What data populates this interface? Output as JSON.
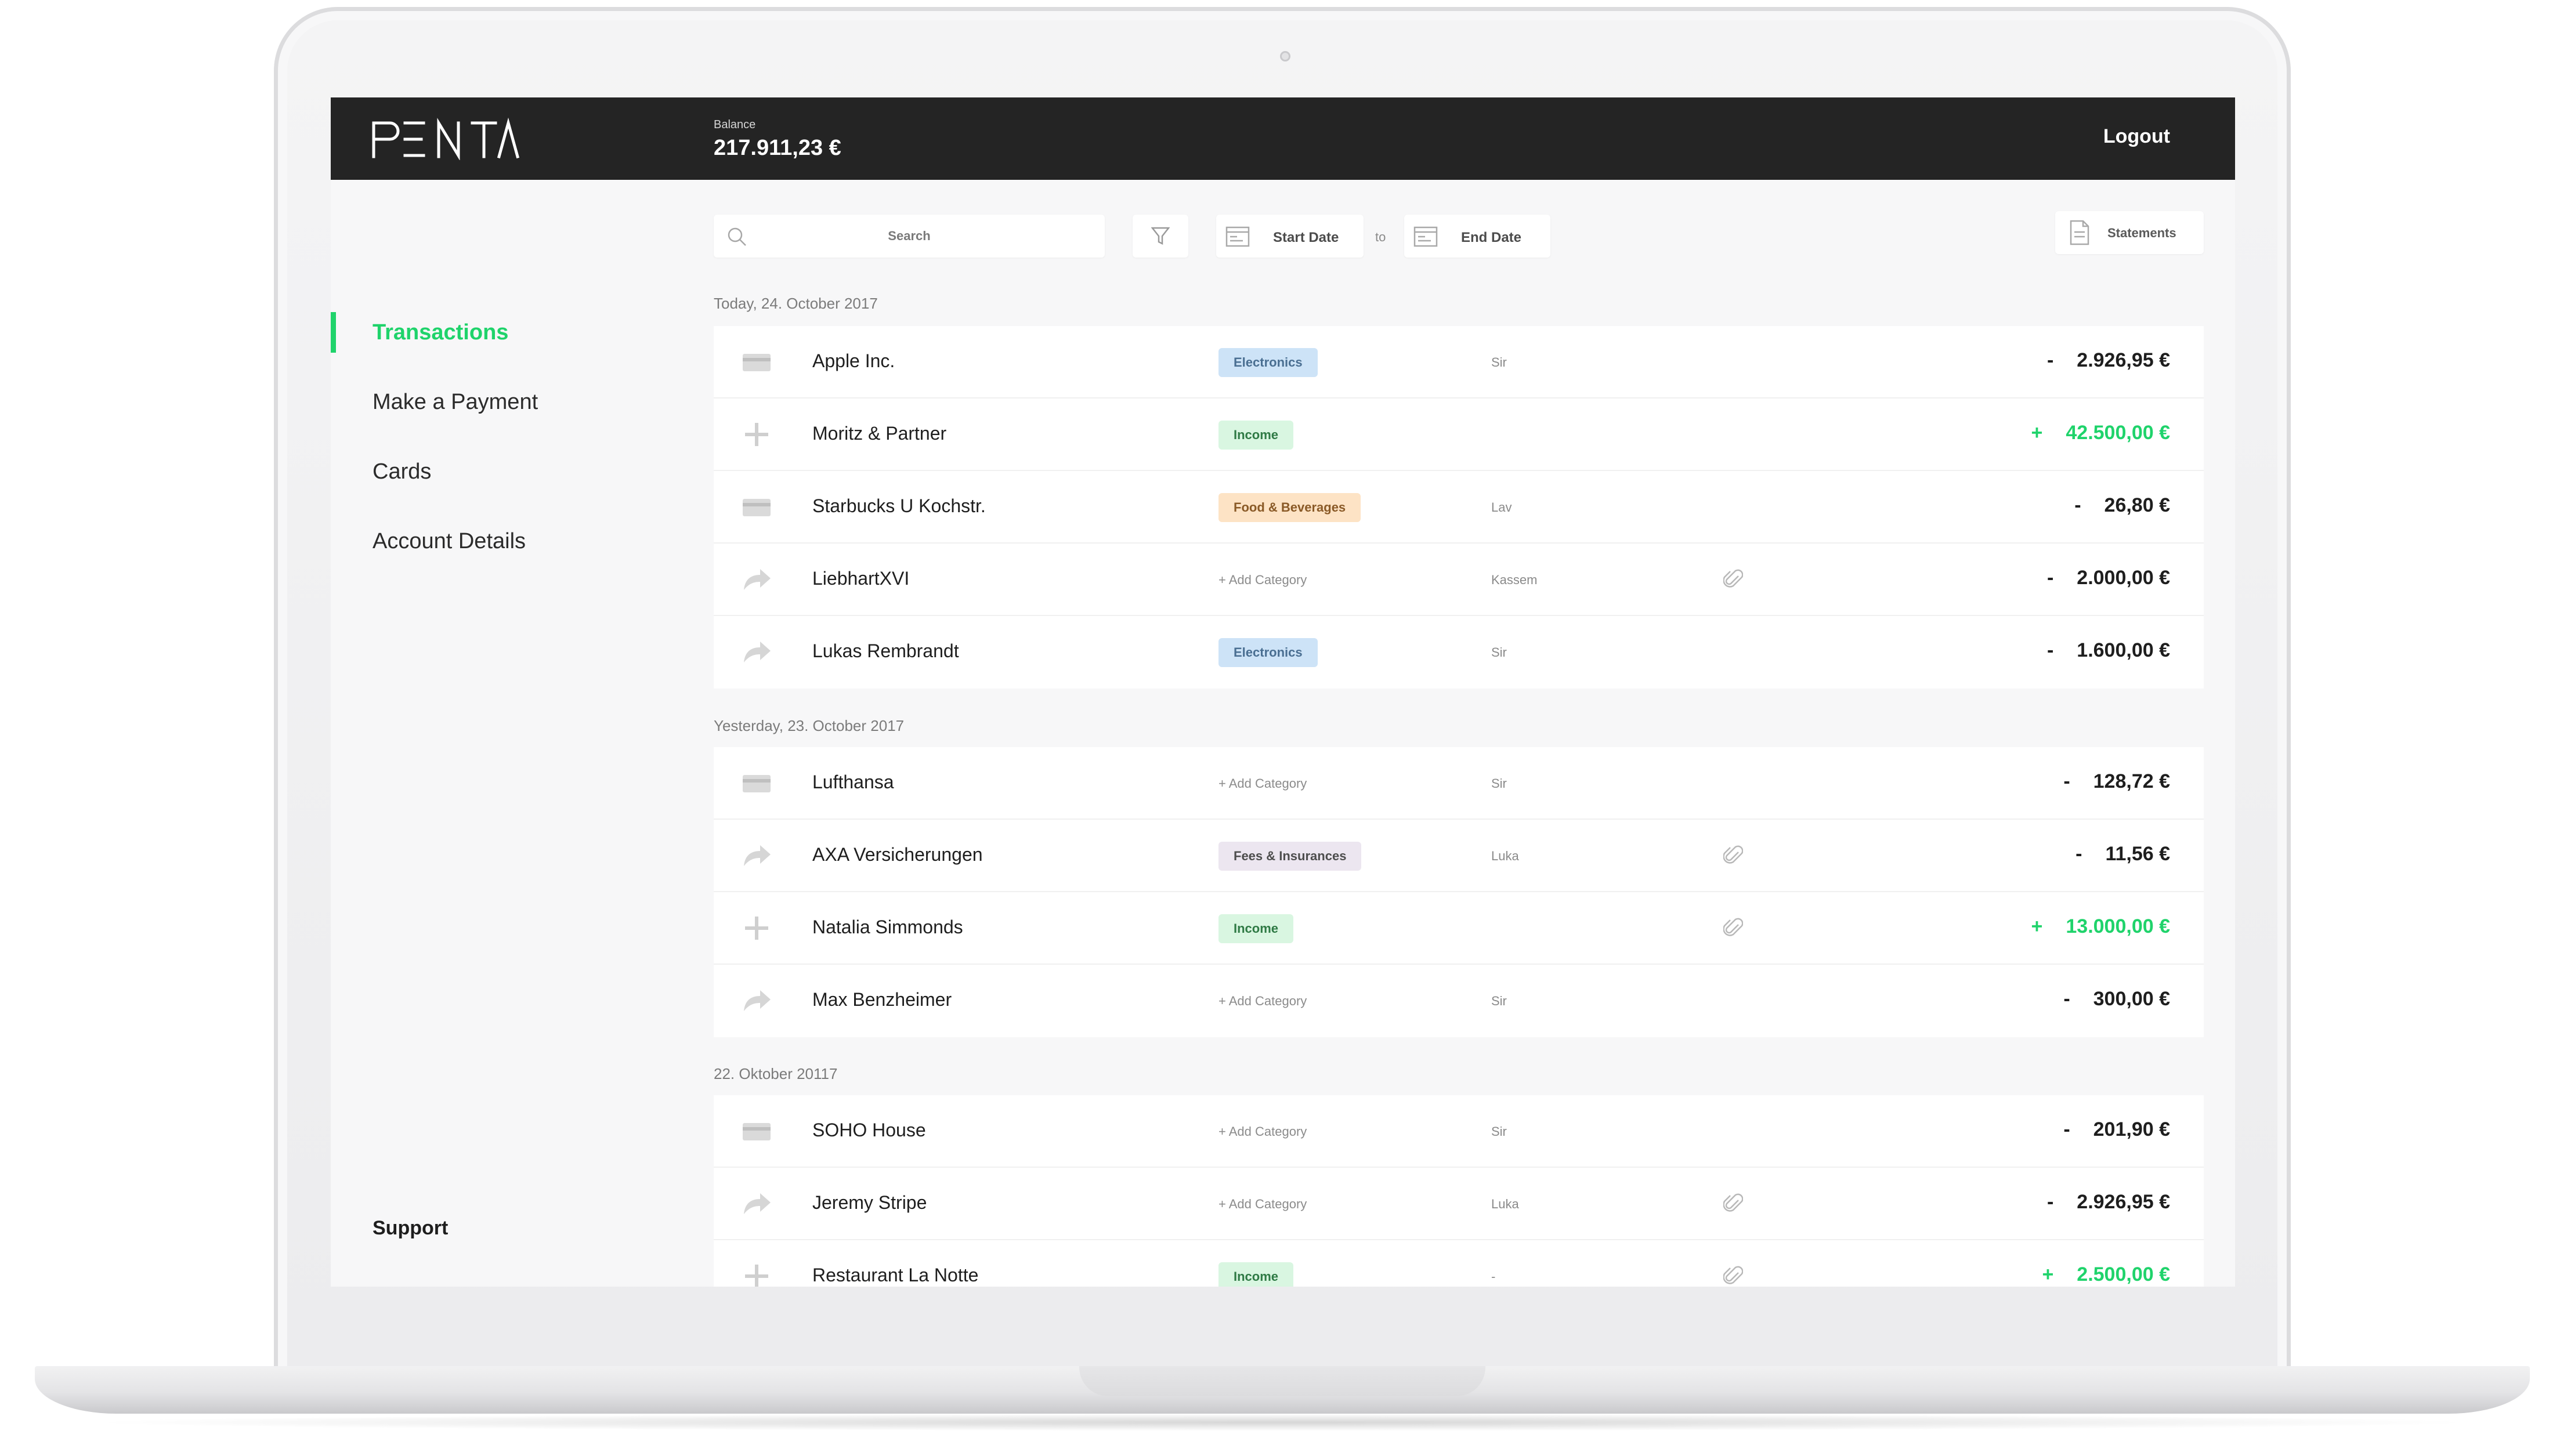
{
  "app": {
    "brand": "PENTA",
    "balance_label": "Balance",
    "balance_value": "217.911,23 €",
    "logout_label": "Logout"
  },
  "sidebar": {
    "items": [
      {
        "label": "Transactions",
        "active": true
      },
      {
        "label": "Make a Payment",
        "active": false
      },
      {
        "label": "Cards",
        "active": false
      },
      {
        "label": "Account Details",
        "active": false
      }
    ],
    "support_label": "Support"
  },
  "toolbar": {
    "search_label": "Search",
    "start_date_label": "Start Date",
    "to_label": "to",
    "end_date_label": "End Date",
    "statements_label": "Statements"
  },
  "colors": {
    "accent_green": "#1fd36b",
    "topbar": "#242424",
    "tag_electronics": "#cde3f7",
    "tag_income": "#d9f6e1",
    "tag_food": "#fde3c5",
    "tag_fees": "#ece6f0"
  },
  "groups": [
    {
      "header": "Today, 24. October 2017",
      "rows": [
        {
          "icon": "card-icon",
          "name": "Apple Inc.",
          "category": "Electronics",
          "category_type": "electronics",
          "person": "Sir",
          "attachment": false,
          "sign": "-",
          "amount": "2.926,95 €",
          "positive": false
        },
        {
          "icon": "plus-icon",
          "name": "Moritz & Partner",
          "category": "Income",
          "category_type": "income",
          "person": "",
          "attachment": false,
          "sign": "+",
          "amount": "42.500,00 €",
          "positive": true
        },
        {
          "icon": "card-icon",
          "name": "Starbucks U Kochstr.",
          "category": "Food & Beverages",
          "category_type": "food",
          "person": "Lav",
          "attachment": false,
          "sign": "-",
          "amount": "26,80 €",
          "positive": false
        },
        {
          "icon": "transfer-arrow-icon",
          "name": "LiebhartXVI",
          "category": "+ Add Category",
          "category_type": "add",
          "person": "Kassem",
          "attachment": true,
          "sign": "-",
          "amount": "2.000,00 €",
          "positive": false
        },
        {
          "icon": "transfer-arrow-icon",
          "name": "Lukas Rembrandt",
          "category": "Electronics",
          "category_type": "electronics",
          "person": "Sir",
          "attachment": false,
          "sign": "-",
          "amount": "1.600,00 €",
          "positive": false
        }
      ]
    },
    {
      "header": "Yesterday, 23. October 2017",
      "rows": [
        {
          "icon": "card-icon",
          "name": "Lufthansa",
          "category": "+ Add Category",
          "category_type": "add",
          "person": "Sir",
          "attachment": false,
          "sign": "-",
          "amount": "128,72 €",
          "positive": false
        },
        {
          "icon": "transfer-arrow-icon",
          "name": "AXA Versicherungen",
          "category": "Fees & Insurances",
          "category_type": "fees",
          "person": "Luka",
          "attachment": true,
          "sign": "-",
          "amount": "11,56 €",
          "positive": false
        },
        {
          "icon": "plus-icon",
          "name": "Natalia Simmonds",
          "category": "Income",
          "category_type": "income",
          "person": "",
          "attachment": true,
          "sign": "+",
          "amount": "13.000,00 €",
          "positive": true
        },
        {
          "icon": "transfer-arrow-icon",
          "name": "Max Benzheimer",
          "category": "+ Add Category",
          "category_type": "add",
          "person": "Sir",
          "attachment": false,
          "sign": "-",
          "amount": "300,00 €",
          "positive": false
        }
      ]
    },
    {
      "header": "22. Oktober 20117",
      "rows": [
        {
          "icon": "card-icon",
          "name": "SOHO House",
          "category": "+ Add Category",
          "category_type": "add",
          "person": "Sir",
          "attachment": false,
          "sign": "-",
          "amount": "201,90 €",
          "positive": false
        },
        {
          "icon": "transfer-arrow-icon",
          "name": "Jeremy Stripe",
          "category": "+ Add Category",
          "category_type": "add",
          "person": "Luka",
          "attachment": true,
          "sign": "-",
          "amount": "2.926,95 €",
          "positive": false
        },
        {
          "icon": "plus-icon",
          "name": "Restaurant La Notte",
          "category": "Income",
          "category_type": "income",
          "person": "-",
          "attachment": true,
          "sign": "+",
          "amount": "2.500,00 €",
          "positive": true
        }
      ]
    }
  ]
}
